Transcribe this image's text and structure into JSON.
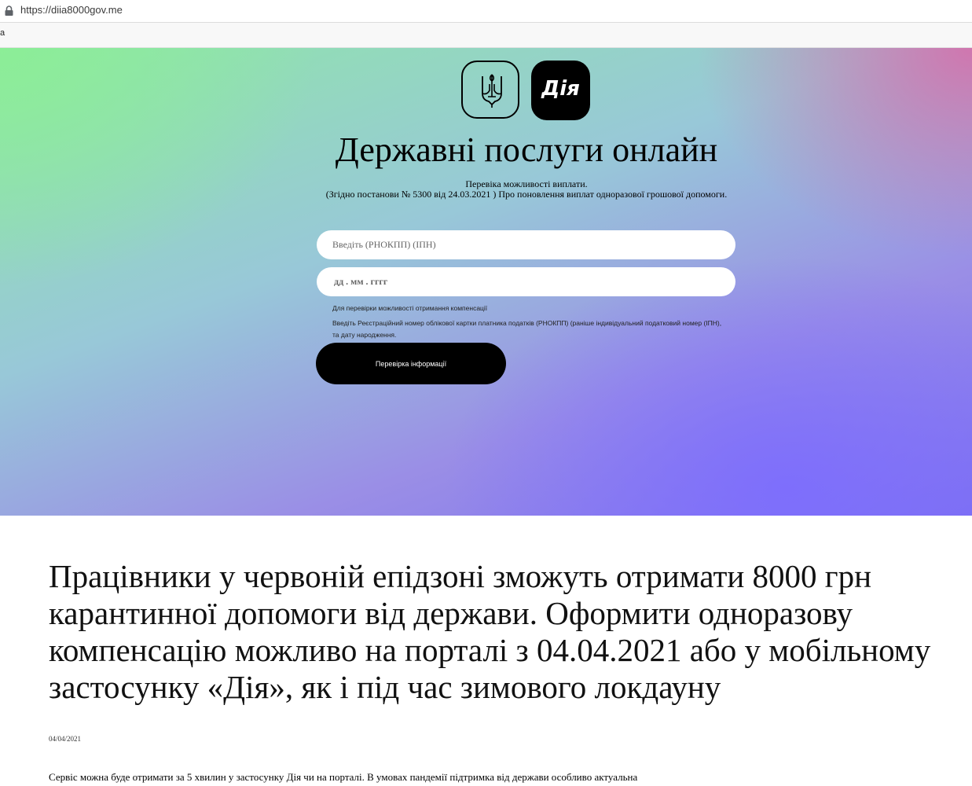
{
  "browser": {
    "url": "https://diia8000gov.me",
    "tab_fragment": "a",
    "lock_icon": "lock-icon"
  },
  "hero": {
    "coat_icon": "trident-icon",
    "logo_text": "Дія",
    "title": "Державні послуги онлайн",
    "subtitle_line1": "Перевіка можливості виплати.",
    "subtitle_line2": "(Згідно постанови № 5300 від 24.03.2021 ) Про поновлення виплат одноразової грошової допомоги.",
    "ipn_placeholder": "Введіть (РНОКПП) (ІПН)",
    "date_placeholder": "дд . мм . гггг",
    "note_line1": "Для перевірки можливості отримання компенсації",
    "note_line2": "Введіть Реєстраційний номер облікової картки платника податків (РНОКПП) (раніше індивідуальний податковий номер (ІПН), та дату народження.",
    "button_label": "Перевірка інформації",
    "colors": {
      "green": "#8fe6a8",
      "pink": "#d66eaa",
      "violet": "#7d70f0"
    }
  },
  "article": {
    "title": "Працівники у червоній епідзоні зможуть отримати 8000 грн карантинної допомоги від держави. Оформити одноразову компенсацію можливо на порталі з 04.04.2021 або у мобільному застосунку «Дія», як і під час зимового локдауну",
    "date": "04/04/2021",
    "body": "Сервіс можна буде отримати за 5 хвилин у застосунку Дія чи на порталі. В умовах пандемії підтримка від держави особливо актуальна"
  }
}
